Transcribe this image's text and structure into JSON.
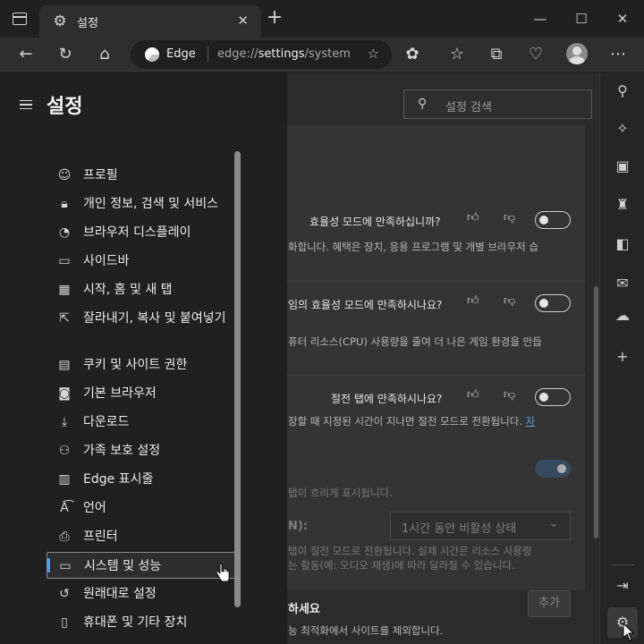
{
  "window": {
    "tab_title": "설정",
    "tab_close": "✕",
    "new_tab": "+",
    "minimize": "—",
    "maximize": "☐",
    "close": "✕"
  },
  "address_bar": {
    "brand": "Edge",
    "url_prefix": "edge://",
    "url_host": "settings",
    "url_path": "/system"
  },
  "search": {
    "placeholder": "설정 검색"
  },
  "nav": {
    "title": "설정",
    "items": [
      {
        "label": "프로필",
        "icon": "profile-icon"
      },
      {
        "label": "개인 정보, 검색 및 서비스",
        "icon": "lock-icon"
      },
      {
        "label": "브라우저 디스플레이",
        "icon": "palette-icon"
      },
      {
        "label": "사이드바",
        "icon": "sidebar-icon"
      },
      {
        "label": "시작, 홈 및 새 탭",
        "icon": "home-grid-icon"
      },
      {
        "label": "잘라내기, 복사 및 붙여넣기",
        "icon": "share-icon"
      },
      {
        "label": "쿠키 및 사이트 권한",
        "icon": "cookie-icon"
      },
      {
        "label": "기본 브라우저",
        "icon": "browser-icon"
      },
      {
        "label": "다운로드",
        "icon": "download-icon"
      },
      {
        "label": "가족 보호 설정",
        "icon": "family-icon"
      },
      {
        "label": "Edge 표시줄",
        "icon": "edge-bar-icon"
      },
      {
        "label": "언어",
        "icon": "language-icon"
      },
      {
        "label": "프린터",
        "icon": "printer-icon"
      },
      {
        "label": "시스템 및 성능",
        "icon": "laptop-icon"
      },
      {
        "label": "원래대로 설정",
        "icon": "reset-icon"
      },
      {
        "label": "휴대폰 및 기타 장치",
        "icon": "phone-icon"
      }
    ],
    "selected_index": 13
  },
  "main": {
    "feedback1": {
      "question": "효율성 모드에 만족하십니까?",
      "desc": "화합니다. 혜택은 장치, 응용 프로그램 및 개별 브라우저 습"
    },
    "feedback2": {
      "question": "임의 효율성 모드에 만족하시나요?",
      "desc": "퓨터 리소스(CPU) 사용량을 줄여 더 나은 게임 환경을 만듭"
    },
    "feedback3": {
      "question": "절전 탭에 만족하시나요?",
      "desc": "장할 때 지정된 시간이 지나면 절전 모드로 전환됩니다.",
      "link": "자"
    },
    "fade_desc": "탭이 흐리게 표시됩니다.",
    "timeout_label": "N):",
    "timeout_value": "1시간 동안 비활성 상태",
    "timeout_desc1": "탭이 절전 모드로 전환됩니다. 실제 시간은 리소스 사용량",
    "timeout_desc2": "는 활동(예: 오디오 재생)에 따라 달라질 수 있습니다.",
    "exclude_label": "하세요",
    "exclude_desc": "능 최적화에서 사이트를 제외합니다.",
    "add_button": "추가"
  },
  "colors": {
    "accent": "#4aa0ff",
    "link": "#5aa0e8"
  }
}
